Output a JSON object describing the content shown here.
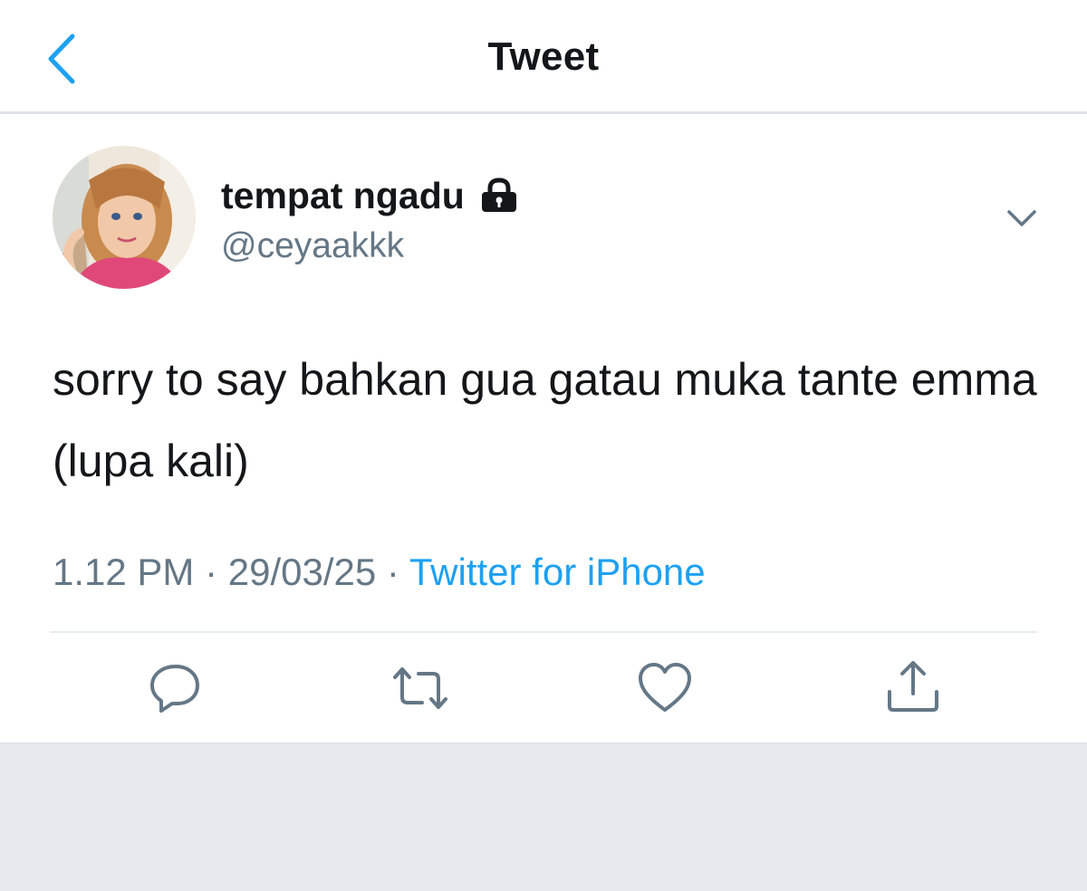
{
  "nav": {
    "title": "Tweet",
    "back_icon": "chevron-left-icon"
  },
  "tweet": {
    "author": {
      "display_name": "tempat ngadu",
      "username": "@ceyaakkk",
      "protected_icon": "lock-icon",
      "avatar": "doll-avatar"
    },
    "text": "sorry to say bahkan gua gatau muka tante emma (lupa kali)",
    "time": "1.12 PM",
    "separator": " · ",
    "date": "29/03/25",
    "source": "Twitter for iPhone",
    "more_icon": "chevron-down-icon"
  },
  "actions": [
    {
      "name": "reply",
      "icon": "reply-icon"
    },
    {
      "name": "retweet",
      "icon": "retweet-icon"
    },
    {
      "name": "like",
      "icon": "heart-icon"
    },
    {
      "name": "share",
      "icon": "share-icon"
    }
  ],
  "colors": {
    "accent": "#1da1f2",
    "text_primary": "#14171a",
    "text_secondary": "#657786",
    "divider": "#e6ecf0",
    "footer_bg": "#e6e9ee"
  }
}
